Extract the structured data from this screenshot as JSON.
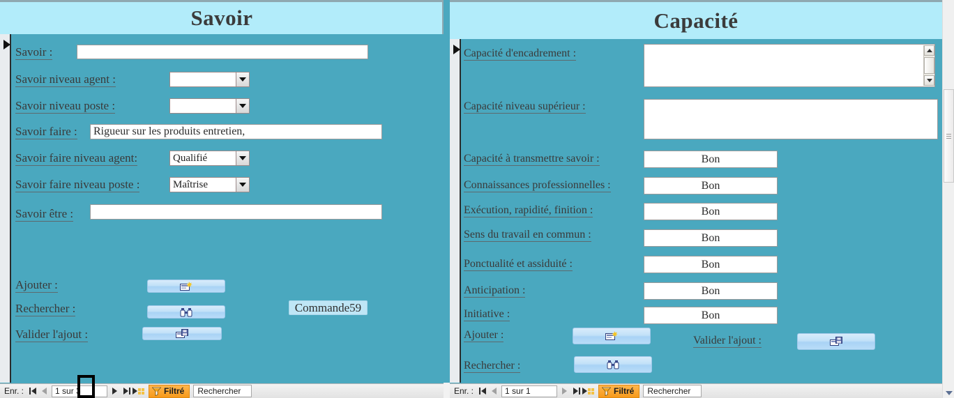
{
  "theme": {
    "form_bg": "#4aa8bf",
    "header_bg": "#b2ecfa",
    "label_color": "#3a3a3a",
    "button_blue": "#bfe6f6",
    "filter_orange": "#f79a1b"
  },
  "left_form": {
    "title": "Savoir",
    "fields": [
      {
        "label": "Savoir :",
        "type": "text",
        "value": ""
      },
      {
        "label": "Savoir niveau agent :",
        "type": "combo",
        "value": ""
      },
      {
        "label": "Savoir niveau poste :",
        "type": "combo",
        "value": ""
      },
      {
        "label": "Savoir faire :",
        "type": "text",
        "value": "Rigueur sur les produits entretien,"
      },
      {
        "label": "Savoir faire niveau agent:",
        "type": "combo",
        "value": "Qualifié"
      },
      {
        "label": "Savoir faire niveau poste :",
        "type": "combo",
        "value": "Maîtrise"
      },
      {
        "label": "Savoir être :",
        "type": "text",
        "value": ""
      }
    ],
    "actions": [
      {
        "label": "Ajouter :",
        "icon": "new-record-icon"
      },
      {
        "label": "Rechercher :",
        "icon": "binoculars-icon"
      },
      {
        "label": "Valider l'ajout :",
        "icon": "save-record-icon"
      }
    ],
    "extra_button": "Commande59",
    "nav": {
      "record_label": "Enr. :",
      "position": "1 sur 3",
      "filter_label": "Filtré",
      "search_placeholder": "Rechercher"
    }
  },
  "right_form": {
    "title": "Capacité",
    "fields": [
      {
        "label": "Capacité d'encadrement :",
        "type": "textarea-scroll",
        "value": ""
      },
      {
        "label": "Capacité niveau supérieur :",
        "type": "textarea",
        "value": ""
      },
      {
        "label": "Capacité à transmettre savoir :",
        "type": "text",
        "value": "Bon"
      },
      {
        "label": "Connaissances professionnelles :",
        "type": "text",
        "value": "Bon"
      },
      {
        "label": "Exécution, rapidité, finition :",
        "type": "text",
        "value": "Bon"
      },
      {
        "label": "Sens du travail en commun :",
        "type": "text",
        "value": "Bon"
      },
      {
        "label": "Ponctualité et assiduité :",
        "type": "text",
        "value": "Bon"
      },
      {
        "label": "Anticipation :",
        "type": "text",
        "value": "Bon"
      },
      {
        "label": "Initiative :",
        "type": "text",
        "value": "Bon"
      }
    ],
    "actions": [
      {
        "label": "Ajouter :",
        "icon": "new-record-icon"
      },
      {
        "label": "Valider l'ajout :",
        "icon": "save-record-icon"
      },
      {
        "label": "Rechercher :",
        "icon": "binoculars-icon"
      }
    ],
    "nav": {
      "record_label": "Enr. :",
      "position": "1 sur 1",
      "filter_label": "Filtré",
      "search_placeholder": "Rechercher"
    }
  }
}
